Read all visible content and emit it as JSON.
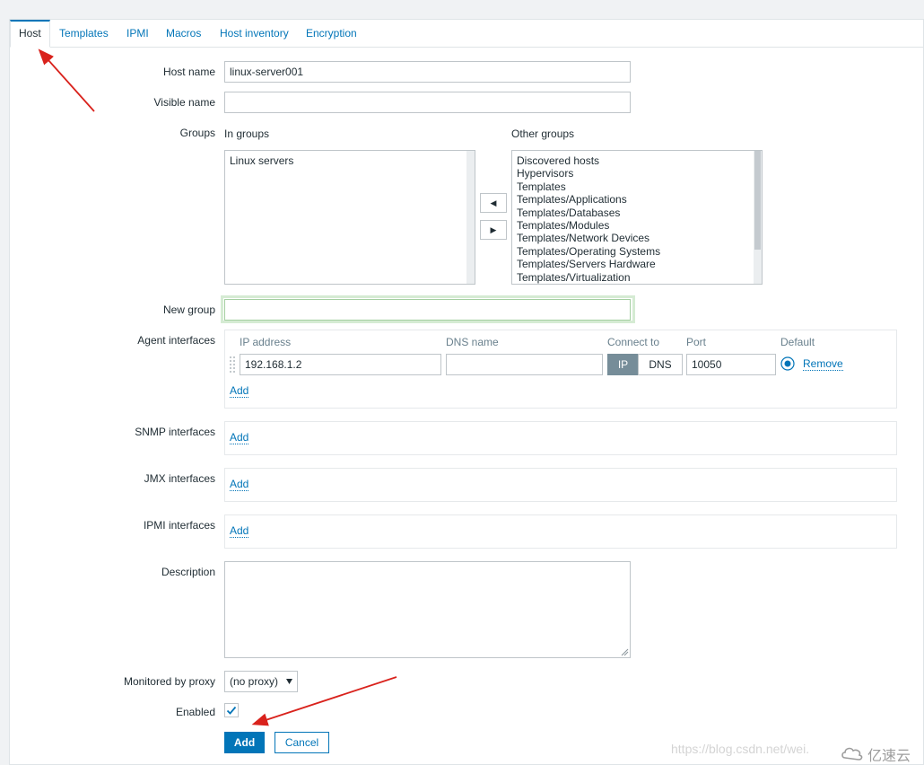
{
  "tabs": [
    "Host",
    "Templates",
    "IPMI",
    "Macros",
    "Host inventory",
    "Encryption"
  ],
  "form": {
    "host_name_label": "Host name",
    "host_name_value": "linux-server001",
    "visible_name_label": "Visible name",
    "visible_name_value": "",
    "groups_label": "Groups",
    "in_groups_label": "In groups",
    "in_groups": [
      "Linux servers"
    ],
    "other_groups_label": "Other groups",
    "other_groups": [
      "Discovered hosts",
      "Hypervisors",
      "Templates",
      "Templates/Applications",
      "Templates/Databases",
      "Templates/Modules",
      "Templates/Network Devices",
      "Templates/Operating Systems",
      "Templates/Servers Hardware",
      "Templates/Virtualization"
    ],
    "move_left_glyph": "◀",
    "move_right_glyph": "▶",
    "new_group_label": "New group",
    "new_group_value": "",
    "agent_interfaces_label": "Agent interfaces",
    "agent_columns": {
      "ip": "IP address",
      "dns": "DNS name",
      "connect": "Connect to",
      "port": "Port",
      "default": "Default"
    },
    "agent_ip": "192.168.1.2",
    "agent_dns": "",
    "connect_options": [
      "IP",
      "DNS"
    ],
    "connect_selected": "IP",
    "agent_port": "10050",
    "remove_label": "Remove",
    "add_label": "Add",
    "snmp_label": "SNMP interfaces",
    "jmx_label": "JMX interfaces",
    "ipmi_label": "IPMI interfaces",
    "description_label": "Description",
    "description_value": "",
    "proxy_label": "Monitored by proxy",
    "proxy_value": "(no proxy)",
    "enabled_label": "Enabled",
    "enabled": true
  },
  "actions": {
    "add": "Add",
    "cancel": "Cancel"
  },
  "watermark": {
    "url": "https://blog.csdn.net/wei.",
    "brand": "亿速云"
  },
  "colors": {
    "accent": "#0275b8",
    "annotation_arrow": "#d9221c",
    "new_group_focus": "#b7dfb5"
  }
}
